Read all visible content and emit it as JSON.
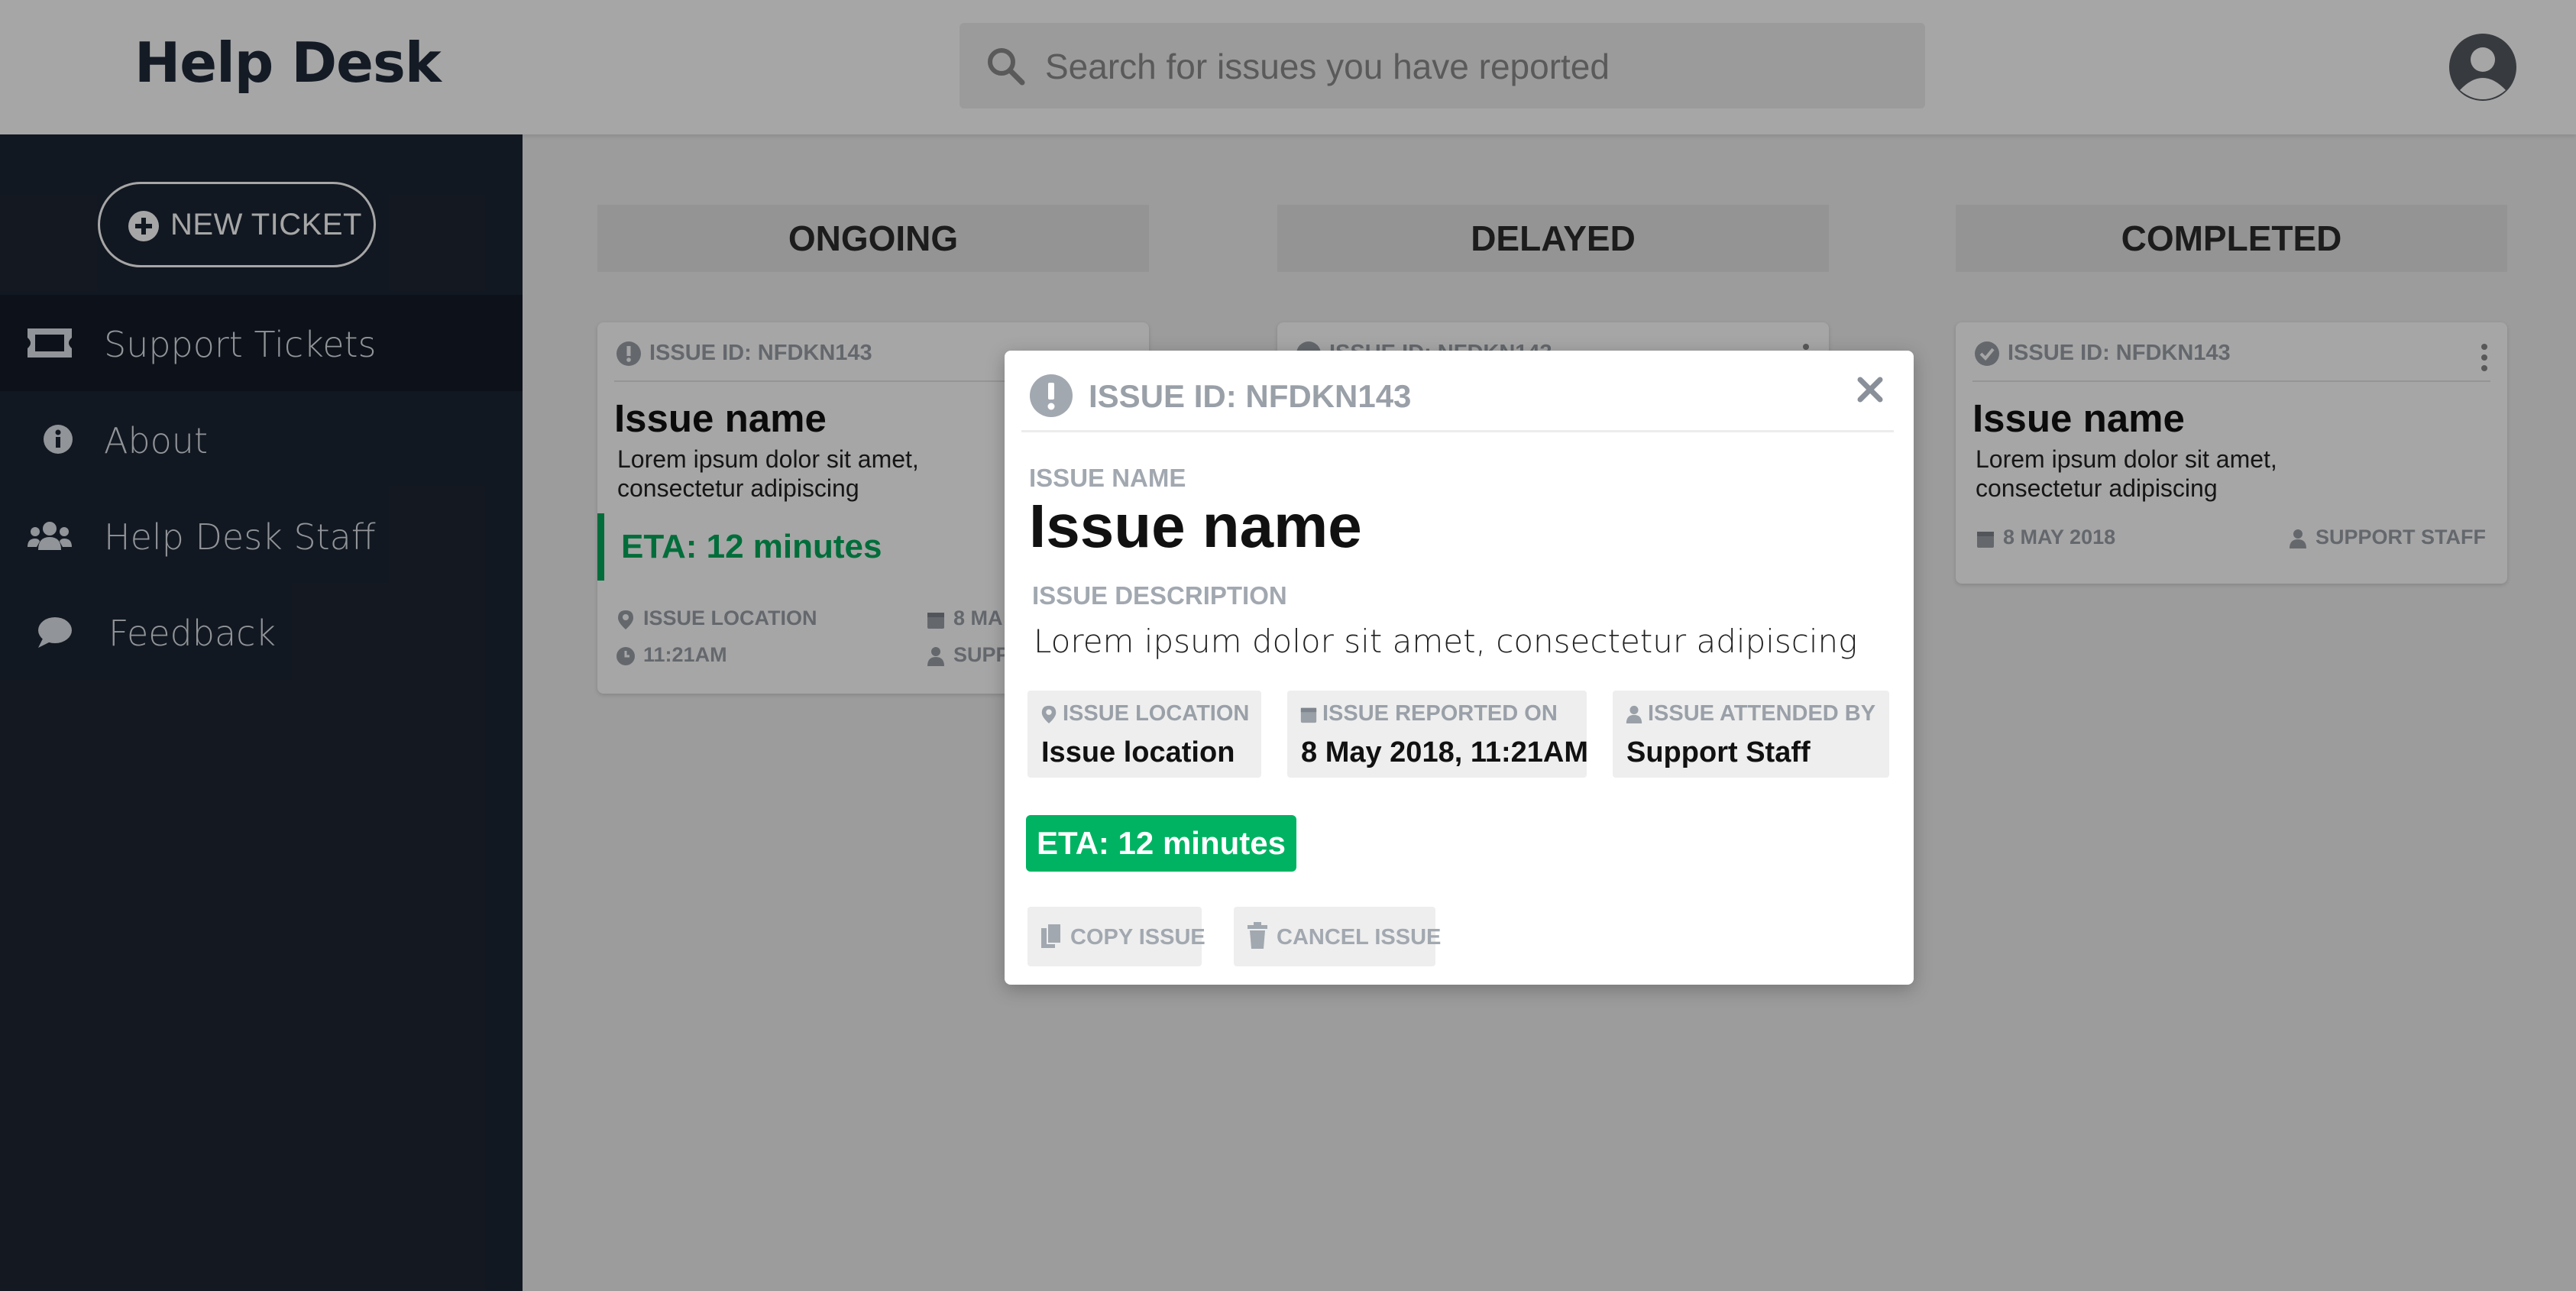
{
  "header": {
    "brand": "Help Desk",
    "search_placeholder": "Search for issues you have reported"
  },
  "sidebar": {
    "new_ticket_label": "NEW TICKET",
    "items": [
      {
        "label": "Support Tickets",
        "icon": "ticket-icon",
        "active": true
      },
      {
        "label": "About",
        "icon": "info-icon",
        "active": false
      },
      {
        "label": "Help Desk Staff",
        "icon": "users-icon",
        "active": false
      },
      {
        "label": "Feedback",
        "icon": "comment-icon",
        "active": false
      }
    ]
  },
  "board": {
    "columns": [
      {
        "title": "ONGOING",
        "card": {
          "issue_id": "ISSUE ID: NFDKN143",
          "name": "Issue name",
          "description": "Lorem ipsum dolor sit amet, consectetur adipiscing",
          "eta": "ETA: 12 minutes",
          "location": "ISSUE LOCATION",
          "time": "11:21AM",
          "date": "8 MA",
          "staff": "SUPP"
        }
      },
      {
        "title": "DELAYED",
        "card": {
          "issue_id": "ISSUE ID: NFDKN143"
        }
      },
      {
        "title": "COMPLETED",
        "card": {
          "issue_id": "ISSUE ID: NFDKN143",
          "name": "Issue name",
          "description": "Lorem ipsum dolor sit amet, consectetur adipiscing",
          "date": "8 MAY 2018",
          "staff": "SUPPORT STAFF"
        }
      }
    ]
  },
  "modal": {
    "issue_id": "ISSUE ID: NFDKN143",
    "name_label": "ISSUE NAME",
    "name": "Issue name",
    "description_label": "ISSUE DESCRIPTION",
    "description": "Lorem ipsum dolor sit amet, consectetur adipiscing",
    "location_label": "ISSUE LOCATION",
    "location": "Issue location",
    "reported_label": "ISSUE REPORTED ON",
    "reported": "8 May 2018, 11:21AM",
    "attended_label": "ISSUE ATTENDED BY",
    "attended": "Support Staff",
    "eta": "ETA: 12 minutes",
    "copy_label": "COPY ISSUE",
    "cancel_label": "CANCEL ISSUE"
  },
  "colors": {
    "sidebar_bg": "#1d2533",
    "sidebar_active": "#141b27",
    "eta_green": "#00b362",
    "muted_gray": "#9aa0a8"
  }
}
